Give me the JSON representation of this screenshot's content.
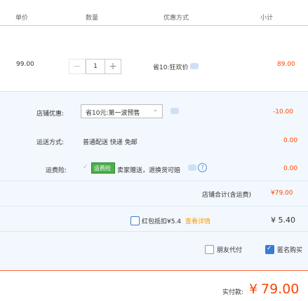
{
  "header": {
    "col_price": "单价",
    "col_qty": "数量",
    "col_discount": "优惠方式",
    "col_subtotal": "小计"
  },
  "item": {
    "price": "99.00",
    "qty": "1",
    "promo": "省10:狂欢价",
    "subtotal": "89.00"
  },
  "shop_discount": {
    "label": "店铺优惠:",
    "selected": "省10元:第一波预售",
    "amount": "-10.00"
  },
  "delivery": {
    "label": "运送方式:",
    "value": "普通配送 快递 免邮",
    "amount": "0.00"
  },
  "insurance": {
    "label": "运费险:",
    "badge": "运费险",
    "text": "卖家赠送，退换货可赔",
    "amount": "0.00"
  },
  "shop_total": {
    "label": "店铺合计(含运费)",
    "amount": "¥79.00"
  },
  "redpacket": {
    "label": "红包抵扣¥5.4",
    "link": "查看详情",
    "amount": "¥ 5.40"
  },
  "options": {
    "friend_pay": "朋友代付",
    "anonymous": "匿名购买"
  },
  "payment": {
    "label": "实付款:",
    "currency": "¥",
    "amount": "79.00"
  },
  "colors": {
    "accent": "#ff4400",
    "link": "#3a7bd5",
    "badge_green": "#4cae4c"
  }
}
